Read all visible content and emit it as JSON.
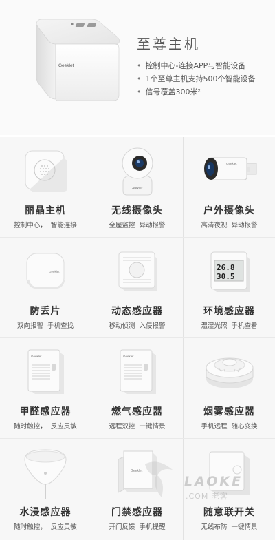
{
  "hero": {
    "title": "至尊主机",
    "features": [
      "控制中心-连接APP与智能设备",
      "1个至尊主机支持500个智能设备",
      "信号覆盖300米²"
    ],
    "brand_label": "Geeklet"
  },
  "products": [
    {
      "name": "丽晶主机",
      "desc1": "控制中心，",
      "desc2": "智能连接",
      "icon": "speaker-hub-icon"
    },
    {
      "name": "无线摄像头",
      "desc1": "全屋监控",
      "desc2": "异动报警",
      "icon": "dome-camera-icon"
    },
    {
      "name": "户外摄像头",
      "desc1": "高清夜视",
      "desc2": "异动报警",
      "icon": "bullet-camera-icon"
    },
    {
      "name": "防丢片",
      "desc1": "双向报警",
      "desc2": "手机查找",
      "icon": "tag-tracker-icon"
    },
    {
      "name": "动态感应器",
      "desc1": "移动侦测",
      "desc2": "入侵报警",
      "icon": "motion-sensor-icon"
    },
    {
      "name": "环境感应器",
      "desc1": "温湿光照",
      "desc2": "手机查看",
      "icon": "environment-sensor-icon"
    },
    {
      "name": "甲醛感应器",
      "desc1": "随时触控，",
      "desc2": "反应灵敏",
      "icon": "formaldehyde-sensor-icon"
    },
    {
      "name": "燃气感应器",
      "desc1": "远程双控",
      "desc2": "一键情景",
      "icon": "gas-sensor-icon"
    },
    {
      "name": "烟雾感应器",
      "desc1": "手机远程",
      "desc2": "随心变换",
      "icon": "smoke-detector-icon"
    },
    {
      "name": "水浸感应器",
      "desc1": "随时触控，",
      "desc2": "反应灵敏",
      "icon": "water-leak-sensor-icon"
    },
    {
      "name": "门禁感应器",
      "desc1": "开门反馈",
      "desc2": "手机提醒",
      "icon": "door-sensor-icon"
    },
    {
      "name": "随意联开关",
      "desc1": "无线布防",
      "desc2": "一键情景",
      "icon": "wireless-switch-icon"
    }
  ],
  "env_display": {
    "line1": "26.8",
    "line2": "30.5"
  },
  "watermark": {
    "text": "LAOKE",
    "sub": ".COM 老客"
  }
}
